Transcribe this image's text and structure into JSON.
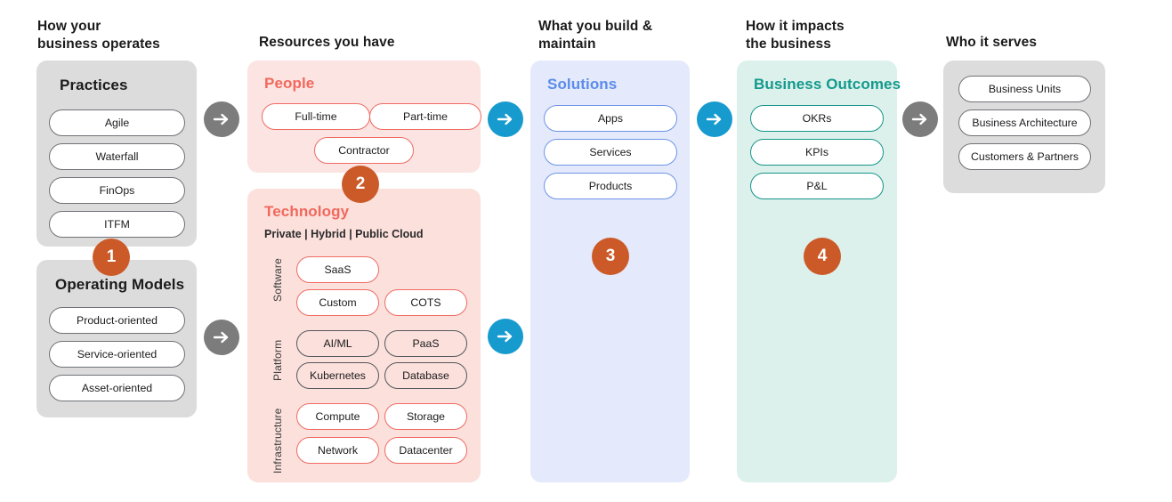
{
  "columns": [
    {
      "id": "operates",
      "header": "How your\nbusiness operates"
    },
    {
      "id": "resources",
      "header": "Resources you have"
    },
    {
      "id": "build",
      "header": "What you build &\nmaintain"
    },
    {
      "id": "impacts",
      "header": "How it impacts\nthe business"
    },
    {
      "id": "serves",
      "header": "Who it serves"
    }
  ],
  "panels": {
    "practices": {
      "title": "Practices",
      "items": [
        "Agile",
        "Waterfall",
        "FinOps",
        "ITFM"
      ]
    },
    "operating_models": {
      "title": "Operating Models",
      "items": [
        "Product-oriented",
        "Service-oriented",
        "Asset-oriented"
      ]
    },
    "people": {
      "title": "People",
      "items": [
        "Full-time",
        "Part-time",
        "Contractor"
      ]
    },
    "technology": {
      "title": "Technology",
      "subtitle": "Private | Hybrid | Public Cloud",
      "layers": [
        {
          "label": "Software",
          "items": [
            "SaaS",
            "Custom",
            "COTS"
          ]
        },
        {
          "label": "Platform",
          "items": [
            "AI/ML",
            "PaaS",
            "Kubernetes",
            "Database"
          ]
        },
        {
          "label": "Infrastructure",
          "items": [
            "Compute",
            "Storage",
            "Network",
            "Datacenter"
          ]
        }
      ]
    },
    "solutions": {
      "title": "Solutions",
      "items": [
        "Apps",
        "Services",
        "Products"
      ]
    },
    "business_outcomes": {
      "title": "Business Outcomes",
      "items": [
        "OKRs",
        "KPIs",
        "P&L"
      ]
    },
    "who_it_serves": {
      "title": "",
      "items": [
        "Business Units",
        "Business Architecture",
        "Customers & Partners"
      ]
    }
  },
  "badges": [
    {
      "number": "1"
    },
    {
      "number": "2"
    },
    {
      "number": "3"
    },
    {
      "number": "4"
    }
  ],
  "arrows": [
    {
      "id": "practices-to-people",
      "style": "gray"
    },
    {
      "id": "operating-to-technology",
      "style": "gray"
    },
    {
      "id": "people-to-solutions",
      "style": "blue"
    },
    {
      "id": "technology-to-solutions",
      "style": "blue"
    },
    {
      "id": "solutions-to-outcomes",
      "style": "blue"
    },
    {
      "id": "outcomes-to-serves",
      "style": "gray"
    }
  ],
  "colors": {
    "accent_orange": "#cc5a28",
    "red": "#f2685c",
    "blue": "#5b8cea",
    "teal": "#14998c",
    "arrow_gray": "#7c7c7c",
    "arrow_blue": "#179bce",
    "panel_gray": "#dcdcdc",
    "panel_pink": "#fbe4e2",
    "panel_blue": "#e4eafb",
    "panel_teal": "#dcf1ec"
  }
}
